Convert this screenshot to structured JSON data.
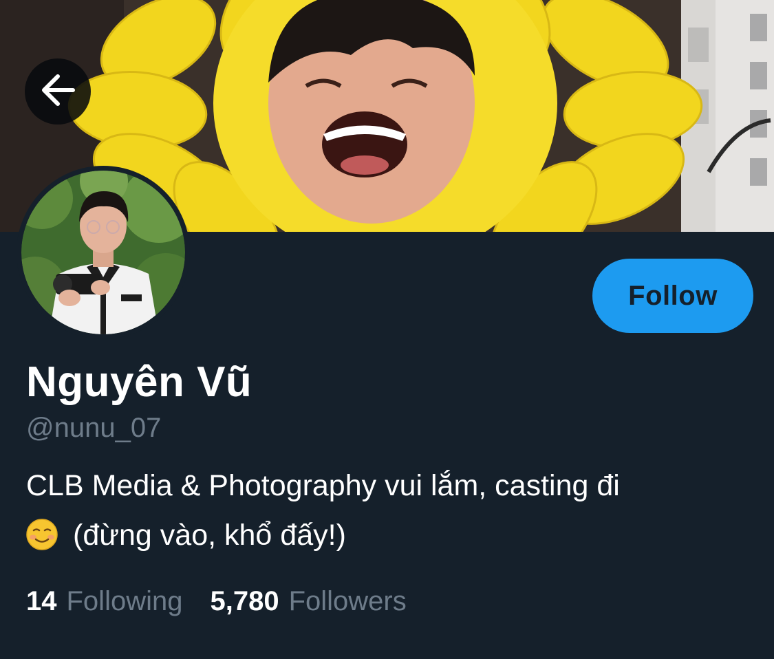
{
  "profile": {
    "display_name": "Nguyên Vũ",
    "handle": "@nunu_07",
    "bio_line1": "CLB Media & Photography vui lắm, casting đi",
    "bio_line2": "(đừng vào, khổ đấy!)",
    "bio_emoji": "smiling-face-emoji"
  },
  "stats": {
    "following_count": "14",
    "following_label": "Following",
    "followers_count": "5,780",
    "followers_label": "Followers"
  },
  "actions": {
    "follow_label": "Follow",
    "back_icon": "arrow-left-icon"
  },
  "colors": {
    "background": "#15202b",
    "accent": "#1d9bf0",
    "secondary_text": "#6e7c8a",
    "primary_text": "#ffffff"
  }
}
